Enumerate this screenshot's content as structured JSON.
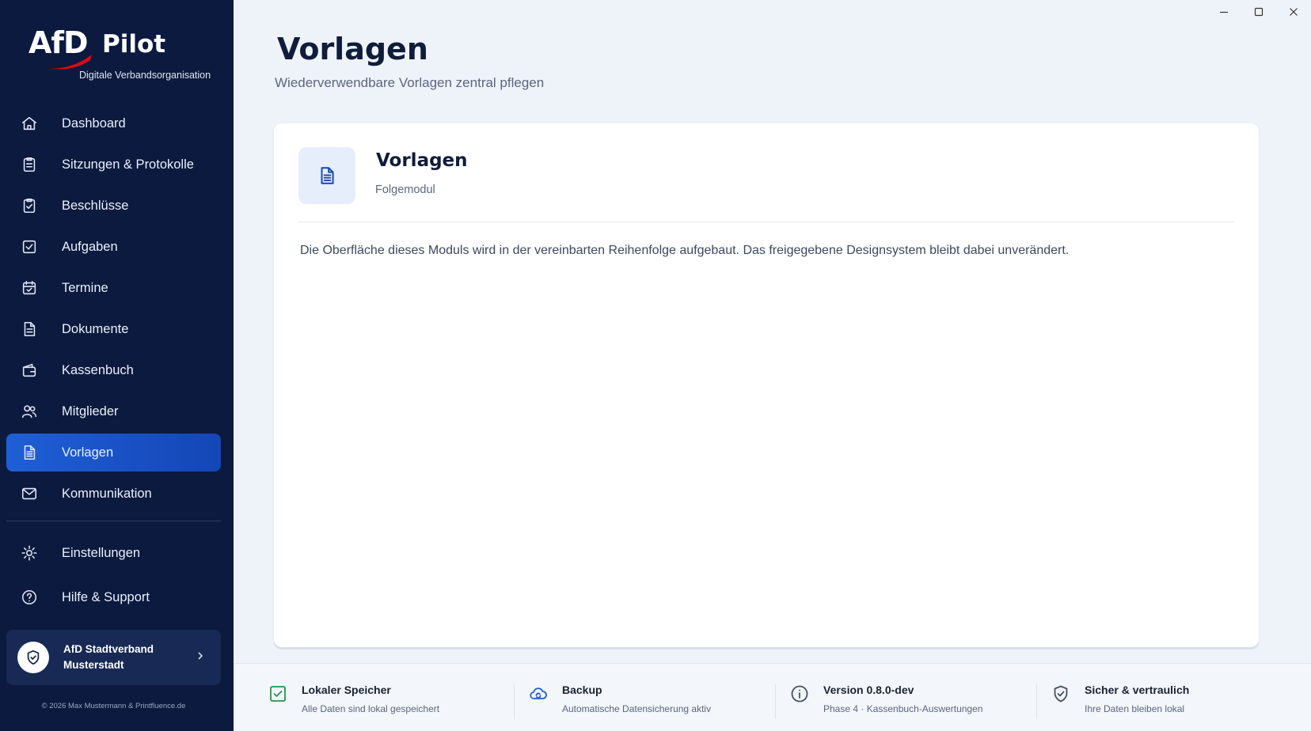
{
  "app": {
    "logo_text": "AfD",
    "logo_product": "Pilot",
    "logo_tagline": "Digitale Verbandsorganisation",
    "brand_red": "#e30613",
    "sidebar_bg": "#0b1a3e",
    "accent": "#1f5fd6"
  },
  "sidebar": {
    "items": [
      {
        "label": "Dashboard",
        "icon": "home-icon"
      },
      {
        "label": "Sitzungen & Protokolle",
        "icon": "clipboard-icon"
      },
      {
        "label": "Beschlüsse",
        "icon": "clipboard-check-icon"
      },
      {
        "label": "Aufgaben",
        "icon": "checkbox-icon"
      },
      {
        "label": "Termine",
        "icon": "calendar-icon"
      },
      {
        "label": "Dokumente",
        "icon": "document-icon"
      },
      {
        "label": "Kassenbuch",
        "icon": "wallet-icon"
      },
      {
        "label": "Mitglieder",
        "icon": "users-icon"
      },
      {
        "label": "Vorlagen",
        "icon": "template-icon",
        "active": true
      },
      {
        "label": "Kommunikation",
        "icon": "mail-icon"
      }
    ],
    "bottom_items": [
      {
        "label": "Einstellungen",
        "icon": "gear-icon"
      },
      {
        "label": "Hilfe & Support",
        "icon": "help-icon"
      }
    ],
    "org": {
      "name": "AfD Stadtverband Musterstadt"
    },
    "copyright": "© 2026 Max Mustermann & Printfluence.de"
  },
  "header": {
    "title": "Vorlagen",
    "subtitle": "Wiederverwendbare Vorlagen zentral pflegen"
  },
  "card": {
    "title": "Vorlagen",
    "subtitle": "Folgemodul",
    "text": "Die Oberfläche dieses Moduls wird in der vereinbarten Reihenfolge aufgebaut. Das freigegebene Designsystem bleibt dabei unverändert."
  },
  "footer": {
    "items": [
      {
        "title": "Lokaler Speicher",
        "subtitle": "Alle Daten sind lokal gespeichert",
        "icon": "checkbox-icon",
        "color": "#1a9a4a"
      },
      {
        "title": "Backup",
        "subtitle": "Automatische Datensicherung aktiv",
        "icon": "cloud-sync-icon",
        "color": "#1f5fd6"
      },
      {
        "title": "Version 0.8.0-dev",
        "subtitle": "Phase 4 · Kassenbuch-Auswertungen",
        "icon": "info-icon",
        "color": "#44506a"
      },
      {
        "title": "Sicher & vertraulich",
        "subtitle": "Ihre Daten bleiben lokal",
        "icon": "shield-check-icon",
        "color": "#44506a"
      }
    ]
  }
}
